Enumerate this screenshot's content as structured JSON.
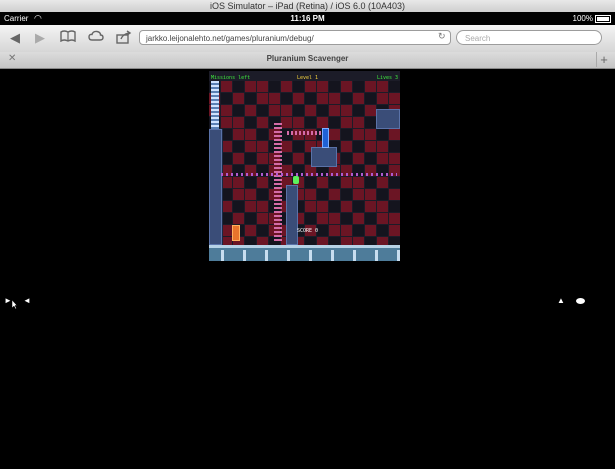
{
  "simulator": {
    "title": "iOS Simulator – iPad (Retina) / iOS 6.0 (10A403)"
  },
  "status_bar": {
    "carrier": "Carrier",
    "time": "11:16 PM",
    "battery": "100%"
  },
  "toolbar": {
    "url": "jarkko.leijonalehto.net/games/pluranium/debug/",
    "search_placeholder": "Search"
  },
  "tab": {
    "title": "Pluranium Scavenger"
  },
  "game": {
    "hud_missions": "Missions left",
    "hud_level": "Level 1",
    "hud_lives": "Lives 3",
    "score": "SCORE 0"
  },
  "touch_controls": {
    "left_group": [
      "left-arrow",
      "right-arrow"
    ],
    "right_group": [
      "up-arrow",
      "fire-dot"
    ]
  },
  "colors": {
    "brick": "#6b1524",
    "steel": "#3a4d78",
    "floor": "#4e7c9a",
    "hud_green": "#3ee83e",
    "hud_yellow": "#f4d23c"
  }
}
